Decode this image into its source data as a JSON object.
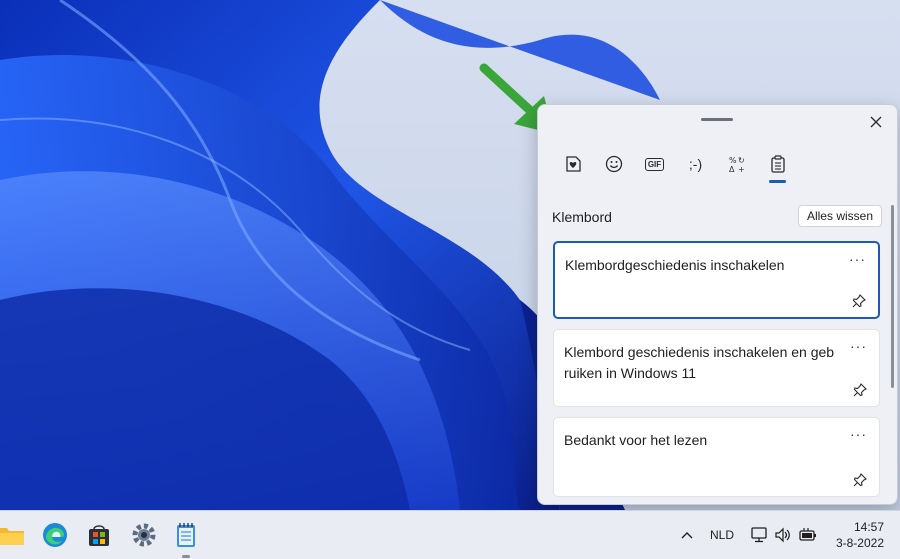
{
  "panel": {
    "section_title": "Klembord",
    "clear_label": "Alles wissen",
    "tabs": [
      {
        "name": "favorites-stickers",
        "label": ""
      },
      {
        "name": "emoji",
        "label": ""
      },
      {
        "name": "gif",
        "label": "GIF"
      },
      {
        "name": "kaomoji",
        "label": ";-)"
      },
      {
        "name": "symbols",
        "label": ""
      },
      {
        "name": "clipboard",
        "label": ""
      }
    ],
    "items": [
      {
        "text": "Klembordgeschiedenis inschakelen"
      },
      {
        "text": "Klembord geschiedenis inschakelen en geb ruiken in Windows 11"
      },
      {
        "text": "Bedankt voor het lezen"
      }
    ]
  },
  "taskbar": {
    "language": "NLD",
    "time": "14:57",
    "date": "3-8-2022"
  },
  "colors": {
    "accent": "#1a5bb8",
    "arrow": "#3aa63a"
  }
}
